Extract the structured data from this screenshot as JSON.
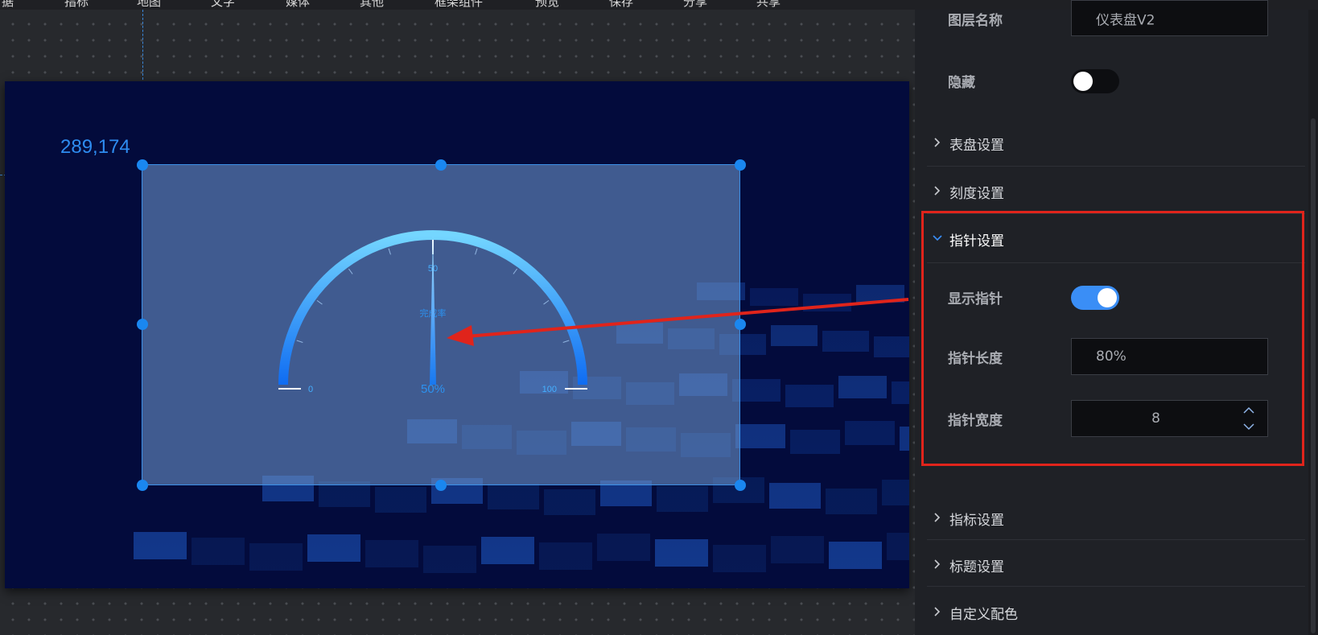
{
  "topbar": {
    "items": [
      "据",
      "指标",
      "地图",
      "文字",
      "媒体",
      "其他",
      "框架组件",
      "预览",
      "保存",
      "分享",
      "共享"
    ]
  },
  "canvas": {
    "coord_readout": "289,174"
  },
  "gauge": {
    "min_label": "0",
    "mid_label": "50",
    "max_label": "100",
    "name": "完成率",
    "value_label": "50%",
    "value": 50,
    "min": 0,
    "max": 100
  },
  "panel": {
    "layer_name_label": "图层名称",
    "layer_name_value": "仪表盘V2",
    "hide_label": "隐藏",
    "hide_on": false,
    "sections": {
      "dial": "表盘设置",
      "scale": "刻度设置",
      "pointer": "指针设置",
      "indicator": "指标设置",
      "title": "标题设置",
      "colors": "自定义配色"
    },
    "pointer": {
      "show_label": "显示指针",
      "show_on": true,
      "length_label": "指针长度",
      "length_value": "80%",
      "width_label": "指针宽度",
      "width_value": "8"
    }
  },
  "colors": {
    "accent": "#3a8ef6",
    "highlight": "#e0241b",
    "panel_bg": "#1f2126",
    "screen_bg": "#030b3c"
  }
}
